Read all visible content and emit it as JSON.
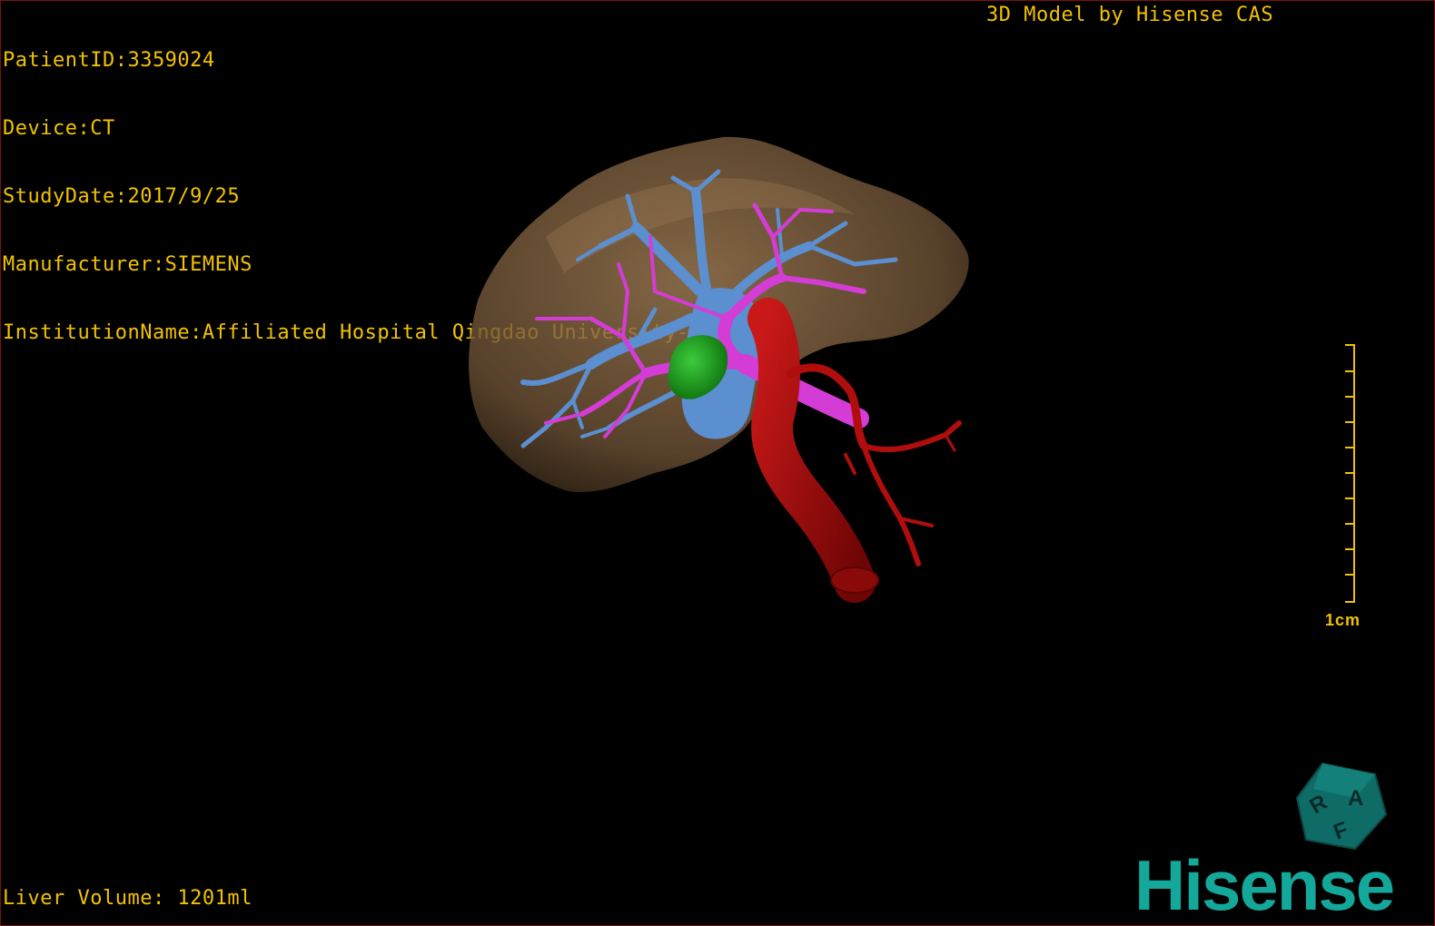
{
  "metadata": {
    "patient_id": "PatientID:3359024",
    "device": "Device:CT",
    "study_date": "StudyDate:2017/9/25",
    "manufacturer": "Manufacturer:SIEMENS",
    "institution": "InstitutionName:Affiliated Hospital Qingdao University-C"
  },
  "credit": "3D Model by Hisense CAS",
  "liver_volume": "Liver Volume: 1201ml",
  "scale": {
    "label": "1cm"
  },
  "orientation_cube": {
    "faces": [
      "R",
      "A",
      "F"
    ]
  },
  "logo": "Hisense",
  "colors": {
    "overlay_text": "#f2c200",
    "liver": "#8a6a48",
    "hepatic_vein": "#5b8fd0",
    "portal_vein": "#d43cd6",
    "artery": "#b00d0d",
    "lesion": "#1a9a1a",
    "logo": "#14a89a"
  }
}
